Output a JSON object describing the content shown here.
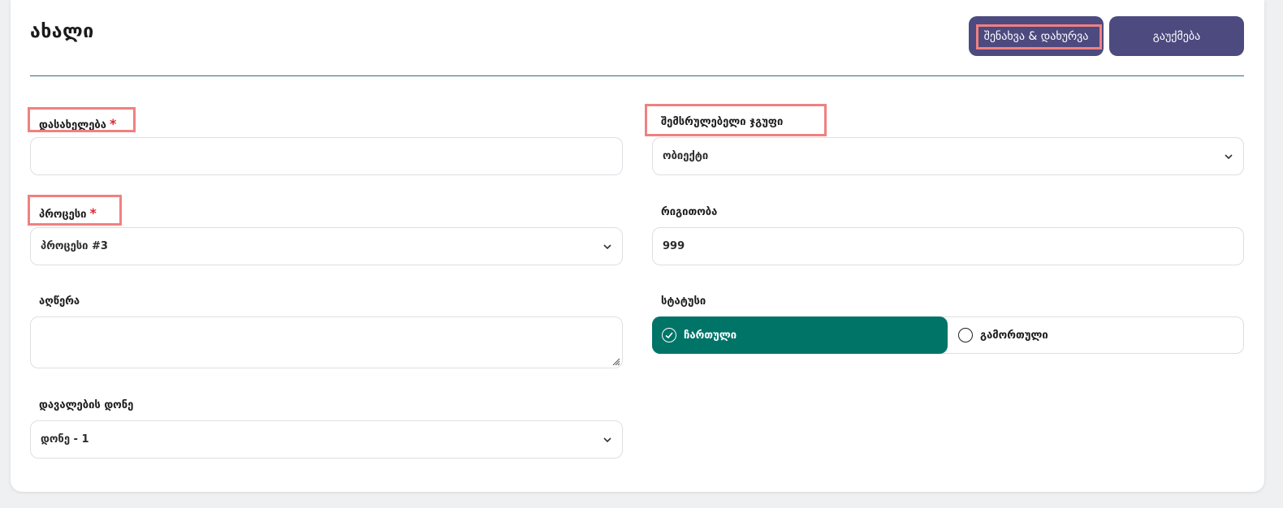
{
  "page": {
    "title": "ახალი",
    "save_close_label": "შენახვა & დახურვა",
    "cancel_label": "გაუქმება"
  },
  "form": {
    "name": {
      "label": "დასახელება",
      "required_mark": "*",
      "value": ""
    },
    "group": {
      "label": "შემსრულებელი ჯგუფი",
      "value": "ობიექტი"
    },
    "process": {
      "label": "პროცესი",
      "required_mark": "*",
      "value": "პროცესი #3"
    },
    "order": {
      "label": "რიგითობა",
      "value": "999"
    },
    "description": {
      "label": "აღწერა",
      "value": ""
    },
    "status": {
      "label": "სტატუსი",
      "on_label": "ჩართული",
      "off_label": "გამორთული",
      "selected": "on"
    },
    "task_level": {
      "label": "დავალების დონე",
      "value": "დონე - 1"
    }
  },
  "colors": {
    "primary_button": "#4c4a7f",
    "active_status": "#017468",
    "required": "#e0252f",
    "highlight": "#f08080"
  }
}
